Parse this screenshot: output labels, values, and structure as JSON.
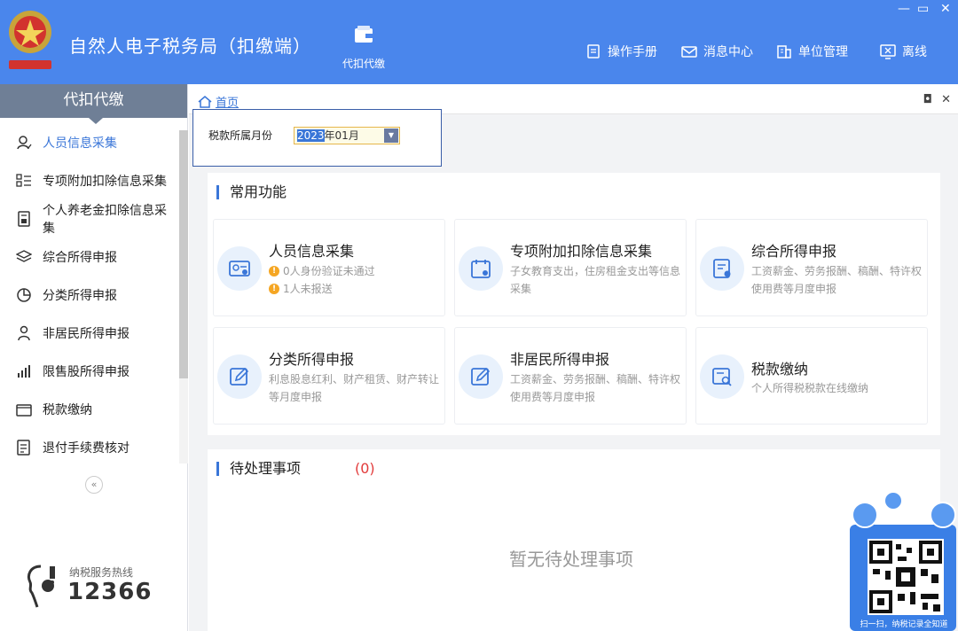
{
  "app": {
    "title": "自然人电子税务局（扣缴端）",
    "module_label": "代扣代缴",
    "header_buttons": [
      {
        "label": "操作手册",
        "icon": "manual-icon"
      },
      {
        "label": "消息中心",
        "icon": "mail-icon"
      },
      {
        "label": "单位管理",
        "icon": "building-icon"
      },
      {
        "label": "离线",
        "icon": "offline-icon"
      }
    ]
  },
  "sidebar": {
    "title": "代扣代缴",
    "items": [
      {
        "label": "人员信息采集",
        "icon": "person-icon"
      },
      {
        "label": "专项附加扣除信息采集",
        "icon": "list-icon"
      },
      {
        "label": "个人养老金扣除信息采集",
        "icon": "document-icon"
      },
      {
        "label": "综合所得申报",
        "icon": "layers-icon"
      },
      {
        "label": "分类所得申报",
        "icon": "pie-icon"
      },
      {
        "label": "非居民所得申报",
        "icon": "user-outline-icon"
      },
      {
        "label": "限售股所得申报",
        "icon": "bar-chart-icon"
      },
      {
        "label": "税款缴纳",
        "icon": "wallet-icon"
      },
      {
        "label": "退付手续费核对",
        "icon": "report-icon"
      }
    ],
    "hotline_label": "纳税服务热线",
    "hotline_number": "12366"
  },
  "tabs": {
    "home": "首页"
  },
  "period": {
    "label": "税款所属月份",
    "year": "2023",
    "rest": "年01月"
  },
  "common": {
    "title": "常用功能",
    "cards": [
      {
        "title": "人员信息采集",
        "warnings": [
          "0人身份验证未通过",
          "1人未报送"
        ]
      },
      {
        "title": "专项附加扣除信息采集",
        "desc": "子女教育支出，住房租金支出等信息采集"
      },
      {
        "title": "综合所得申报",
        "desc": "工资薪金、劳务报酬、稿酬、特许权使用费等月度申报"
      },
      {
        "title": "分类所得申报",
        "desc": "利息股息红利、财产租赁、财产转让等月度申报"
      },
      {
        "title": "非居民所得申报",
        "desc": "工资薪金、劳务报酬、稿酬、特许权使用费等月度申报"
      },
      {
        "title": "税款缴纳",
        "desc": "个人所得税税款在线缴纳"
      }
    ]
  },
  "pending": {
    "title": "待处理事项",
    "count": "(0)",
    "empty": "暂无待处理事项"
  },
  "qr": {
    "caption": "扫一扫，纳税记录全知道"
  },
  "colors": {
    "header": "#4a86ec",
    "accent": "#3a76d8",
    "alert": "#e23b3b",
    "warning": "#f5a623"
  }
}
